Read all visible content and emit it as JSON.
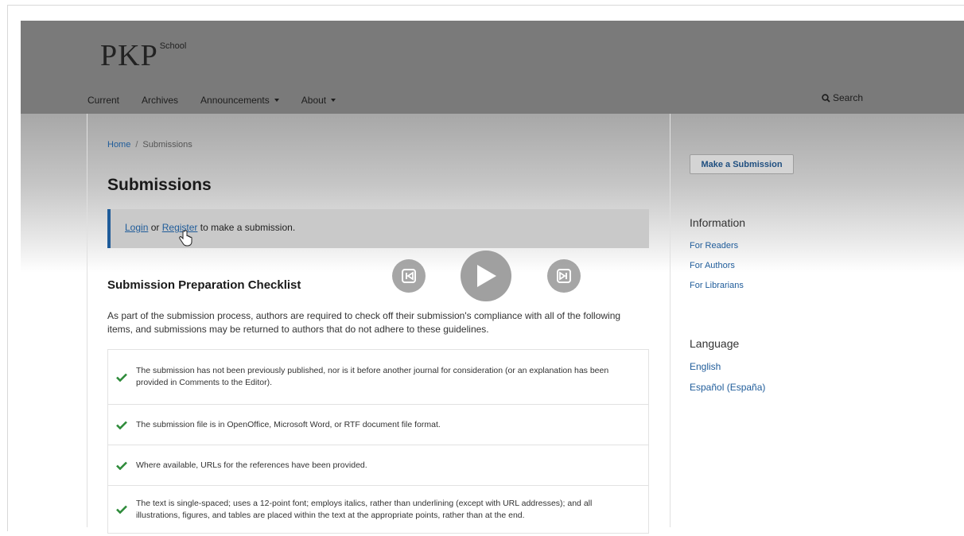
{
  "header": {
    "logo_text": "PKP",
    "logo_sup": "School",
    "nav": [
      {
        "label": "Current"
      },
      {
        "label": "Archives"
      },
      {
        "label": "Announcements"
      },
      {
        "label": "About"
      }
    ],
    "search_label": "Search"
  },
  "breadcrumb": {
    "home": "Home",
    "separator": "/",
    "current": "Submissions"
  },
  "page_title": "Submissions",
  "notice": {
    "login": "Login",
    "or": "or",
    "register": "Register",
    "rest": "to make a submission."
  },
  "checklist": {
    "title": "Submission Preparation Checklist",
    "intro": "As part of the submission process, authors are required to check off their submission's compliance with all of the following items, and submissions may be returned to authors that do not adhere to these guidelines.",
    "items": [
      "The submission has not been previously published, nor is it before another journal for consideration (or an explanation has been provided in Comments to the Editor).",
      "The submission file is in OpenOffice, Microsoft Word, or RTF document file format.",
      "Where available, URLs for the references have been provided.",
      "The text is single-spaced; uses a 12-point font; employs italics, rather than underlining (except with URL addresses); and all illustrations, figures, and tables are placed within the text at the appropriate points, rather than at the end."
    ]
  },
  "sidebar": {
    "make_submission": "Make a Submission",
    "information_heading": "Information",
    "information_links": [
      "For Readers",
      "For Authors",
      "For Librarians"
    ],
    "language_heading": "Language",
    "language_links": [
      "English",
      "Español (España)"
    ]
  },
  "video_controls": [
    "previous-icon",
    "play-icon",
    "next-icon"
  ],
  "colors": {
    "header_bg": "#7a7a7a",
    "link": "#1f5c9a",
    "check": "#2e8b3a"
  }
}
